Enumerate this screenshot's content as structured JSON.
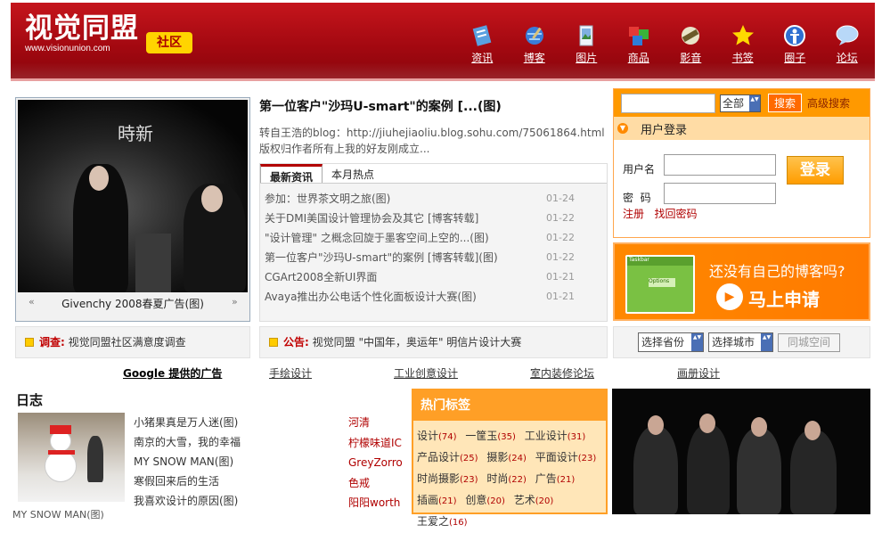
{
  "header": {
    "logo_text": "视觉同盟",
    "logo_url": "www.visionunion.com",
    "community_badge": "社区",
    "nav": [
      {
        "label": "资讯",
        "icon": "news-icon",
        "color": "#5aa0e0"
      },
      {
        "label": "博客",
        "icon": "blog-globe-icon",
        "color": "#3b7dd8"
      },
      {
        "label": "图片",
        "icon": "picture-icon",
        "color": "#7fb0e0"
      },
      {
        "label": "商品",
        "icon": "products-cubes-icon",
        "color": "#3ab23a"
      },
      {
        "label": "影音",
        "icon": "film-reel-icon",
        "color": "#d8d8b0"
      },
      {
        "label": "书签",
        "icon": "star-icon",
        "color": "#ffd800"
      },
      {
        "label": "圈子",
        "icon": "person-circle-icon",
        "color": "#2f6fd0"
      },
      {
        "label": "论坛",
        "icon": "speech-bubble-icon",
        "color": "#b8d8f8"
      }
    ]
  },
  "featured": {
    "image_title": "時新",
    "caption": "Givenchy 2008春夏广告(图)",
    "prev": "«",
    "next": "»"
  },
  "article": {
    "title": "第一位客户\"沙玛U-smart\"的案例 [...(图)",
    "summary": "转自王浩的blog：http://jiuhejiaoliu.blog.sohu.com/75061864.html版权归作者所有上我的好友刚成立..."
  },
  "news_tabs": {
    "tabs": [
      "最新资讯",
      "本月热点"
    ],
    "items": [
      {
        "title": "参加：世界茶文明之旅(图)",
        "date": "01-24"
      },
      {
        "title": "关于DMI美国设计管理协会及其它 [博客转载]",
        "date": "01-22"
      },
      {
        "title": "\"设计管理\" 之概念回旋于墨客空间上空的...(图)",
        "date": "01-22"
      },
      {
        "title": "第一位客户\"沙玛U-smart\"的案例 [博客转载](图)",
        "date": "01-22"
      },
      {
        "title": "CGArt2008全新UI界面",
        "date": "01-21"
      },
      {
        "title": "Avaya推出办公电话个性化面板设计大赛(图)",
        "date": "01-21"
      }
    ]
  },
  "search": {
    "scope": "全部",
    "button": "搜索",
    "advanced": "高级搜索"
  },
  "login": {
    "title": "用户登录",
    "username_label": "用户名",
    "password_label": "密  码",
    "button": "登录",
    "register": "注册",
    "forgot": "找回密码"
  },
  "blog_ad": {
    "question": "还没有自己的博客吗?",
    "cta": "马上申请",
    "window_tab1": "Taskbar",
    "window_tab2": "Options"
  },
  "survey": {
    "label": "调查:",
    "text": "视觉同盟社区满意度调查"
  },
  "notice": {
    "label": "公告:",
    "text": "视觉同盟 \"中国年，奥运年\" 明信片设计大赛"
  },
  "city": {
    "province": "选择省份",
    "city": "选择城市",
    "button": "同城空间"
  },
  "ad_links": [
    "Google 提供的广告",
    "手绘设计",
    "工业创意设计",
    "室内装修论坛",
    "画册设计"
  ],
  "diary": {
    "title": "日志",
    "image_caption": "MY SNOW MAN(图)",
    "items": [
      "小猪果真是万人迷(图)",
      "南京的大雪，我的幸福",
      "MY SNOW MAN(图)",
      "寒假回来后的生活",
      "我喜欢设计的原因(图)"
    ],
    "users": [
      "河清",
      "柠檬味道IC",
      "GreyZorro",
      "色戒",
      "阳阳worth"
    ]
  },
  "hot_tags": {
    "title": "热门标签",
    "tags": [
      {
        "name": "设计",
        "count": "(74)"
      },
      {
        "name": "一筐玉",
        "count": "(35)"
      },
      {
        "name": "工业设计",
        "count": "(31)"
      },
      {
        "name": "产品设计",
        "count": "(25)"
      },
      {
        "name": "摄影",
        "count": "(24)"
      },
      {
        "name": "平面设计",
        "count": "(23)"
      },
      {
        "name": "时尚摄影",
        "count": "(23)"
      },
      {
        "name": "时尚",
        "count": "(22)"
      },
      {
        "name": "广告",
        "count": "(21)"
      },
      {
        "name": "插画",
        "count": "(21)"
      },
      {
        "name": "创意",
        "count": "(20)"
      },
      {
        "name": "艺术",
        "count": "(20)"
      },
      {
        "name": "王爱之",
        "count": "(16)"
      }
    ]
  }
}
